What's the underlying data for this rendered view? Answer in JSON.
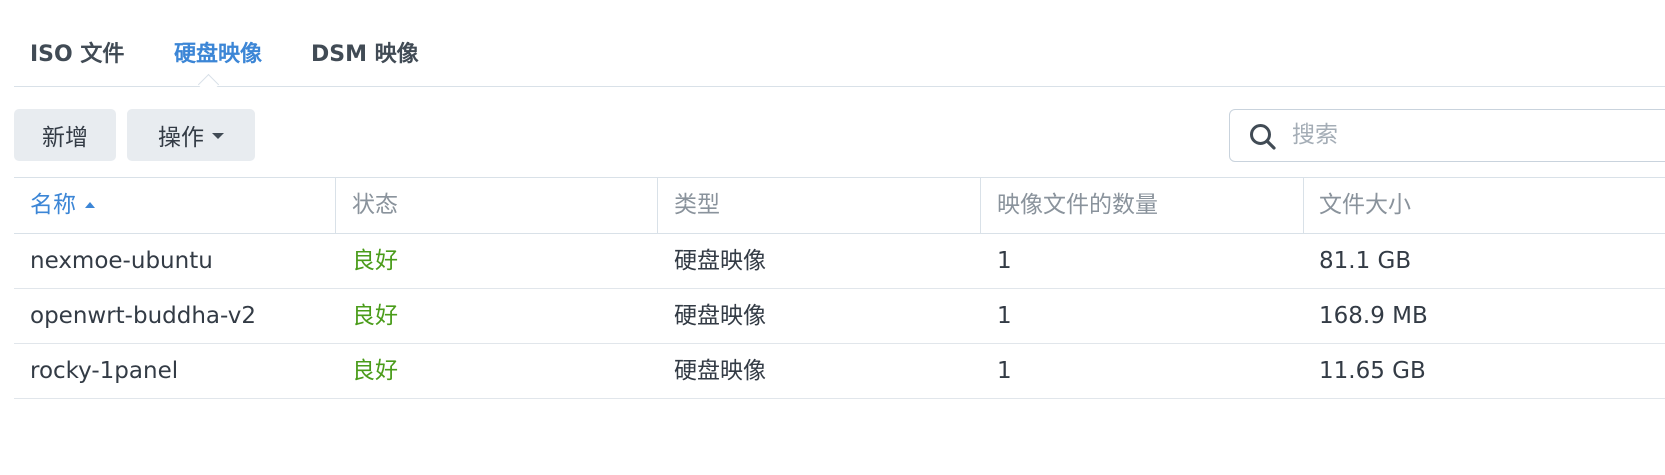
{
  "tabs": [
    {
      "label": "ISO 文件",
      "active": false
    },
    {
      "label": "硬盘映像",
      "active": true
    },
    {
      "label": "DSM 映像",
      "active": false
    }
  ],
  "toolbar": {
    "add_label": "新增",
    "action_label": "操作"
  },
  "search": {
    "placeholder": "搜索",
    "value": ""
  },
  "table": {
    "columns": [
      {
        "label": "名称",
        "sorted": "asc"
      },
      {
        "label": "状态"
      },
      {
        "label": "类型"
      },
      {
        "label": "映像文件的数量"
      },
      {
        "label": "文件大小"
      }
    ],
    "rows": [
      {
        "name": "nexmoe-ubuntu",
        "status": "良好",
        "type": "硬盘映像",
        "count": "1",
        "size": "81.1 GB"
      },
      {
        "name": "openwrt-buddha-v2",
        "status": "良好",
        "type": "硬盘映像",
        "count": "1",
        "size": "168.9 MB"
      },
      {
        "name": "rocky-1panel",
        "status": "良好",
        "type": "硬盘映像",
        "count": "1",
        "size": "11.65 GB"
      }
    ]
  },
  "colors": {
    "accent": "#3c86d6",
    "status_ok": "#4a9c1a",
    "button_bg": "#e8ecf0",
    "border": "#d9e1e8"
  },
  "icons": {
    "search": "search-icon",
    "sort": "sort-ascending-icon",
    "dropdown": "caret-down-icon"
  }
}
